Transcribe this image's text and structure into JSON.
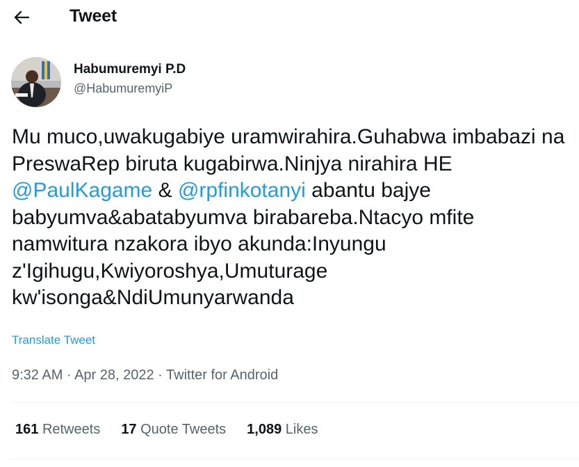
{
  "header": {
    "back_icon": "arrow-left-icon",
    "title": "Tweet"
  },
  "author": {
    "display_name": "Habumuremyi P.D",
    "handle": "@HabumuremyiP",
    "avatar_icon": "profile-photo"
  },
  "tweet": {
    "segments": [
      {
        "text": "Mu muco,uwakugabiye uramwirahira.Guhabwa imbabazi na PreswaRep biruta kugabirwa.Ninjya nirahira HE "
      },
      {
        "text": "@PaulKagame",
        "mention": true
      },
      {
        "text": " & "
      },
      {
        "text": "@rpfinkotanyi",
        "mention": true
      },
      {
        "text": " abantu bajye babyumva&abatabyumva birabareba.Ntacyo mfite namwitura nzakora ibyo akunda:Inyungu z'Igihugu,Kwiyoroshya,Umuturage kw'isonga&NdiUmunyarwanda"
      }
    ],
    "translate_label": "Translate Tweet"
  },
  "meta": {
    "time": "9:32 AM",
    "separator": " · ",
    "date": "Apr 28, 2022",
    "source": "Twitter for Android"
  },
  "stats": {
    "retweets": {
      "count": "161",
      "label": "Retweets"
    },
    "quotes": {
      "count": "17",
      "label": "Quote Tweets"
    },
    "likes": {
      "count": "1,089",
      "label": "Likes"
    }
  },
  "colors": {
    "accent": "#1d9bf0",
    "secondary_text": "#536471",
    "divider": "#eff3f4"
  }
}
